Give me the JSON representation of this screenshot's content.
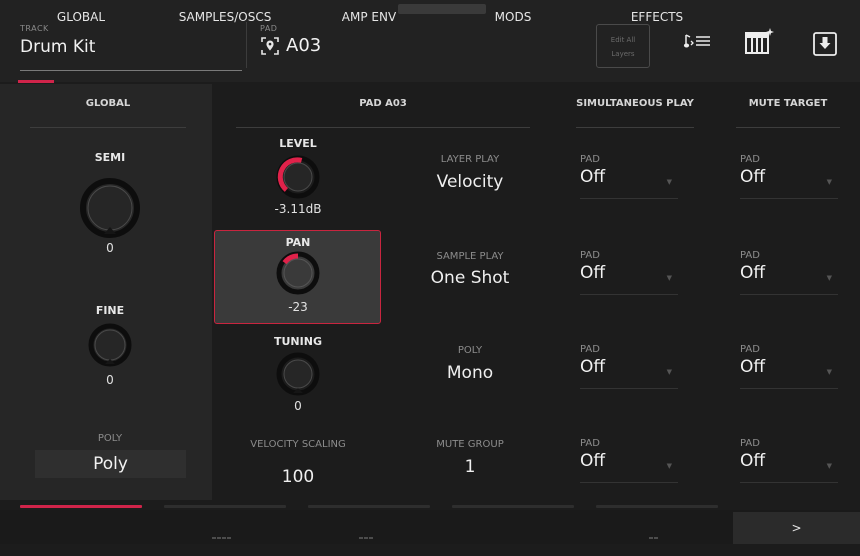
{
  "header": {
    "track_label": "TRACK",
    "track_name": "Drum Kit",
    "pad_label": "PAD",
    "pad_value": "A03",
    "edit_all_line1": "Edit All",
    "edit_all_line2": "Layers"
  },
  "sections": {
    "global": "GLOBAL",
    "pad": "PAD A03",
    "simultaneous": "SIMULTANEOUS PLAY",
    "mute_target": "MUTE TARGET"
  },
  "global": {
    "semi_label": "SEMI",
    "semi_value": "0",
    "fine_label": "FINE",
    "fine_value": "0",
    "poly_label": "POLY",
    "poly_value": "Poly"
  },
  "pad": {
    "level_label": "LEVEL",
    "level_value": "-3.11dB",
    "pan_label": "PAN",
    "pan_value": "-23",
    "tuning_label": "TUNING",
    "tuning_value": "0",
    "velocity_scaling_label": "VELOCITY SCALING",
    "velocity_scaling_value": "100"
  },
  "play": {
    "layer_play_label": "LAYER PLAY",
    "layer_play_value": "Velocity",
    "sample_play_label": "SAMPLE PLAY",
    "sample_play_value": "One Shot",
    "poly_label": "POLY",
    "poly_value": "Mono",
    "mute_group_label": "MUTE GROUP",
    "mute_group_value": "1"
  },
  "simultaneous": [
    {
      "label": "PAD",
      "value": "Off"
    },
    {
      "label": "PAD",
      "value": "Off"
    },
    {
      "label": "PAD",
      "value": "Off"
    },
    {
      "label": "PAD",
      "value": "Off"
    }
  ],
  "mute_target": [
    {
      "label": "PAD",
      "value": "Off"
    },
    {
      "label": "PAD",
      "value": "Off"
    },
    {
      "label": "PAD",
      "value": "Off"
    },
    {
      "label": "PAD",
      "value": "Off"
    }
  ],
  "tabs": {
    "global": "GLOBAL",
    "samples": "SAMPLES/OSCS",
    "amp_env": "AMP ENV",
    "mods": "MODS",
    "effects": "EFFECTS",
    "next": ">"
  },
  "colors": {
    "accent": "#d0244a",
    "background": "#1c1c1c"
  },
  "icons": {
    "pad_icon": "location-pin-icon",
    "list_icon": "note-list-icon",
    "keyboard_icon": "keyboard-sparkle-icon",
    "download_icon": "download-icon"
  }
}
